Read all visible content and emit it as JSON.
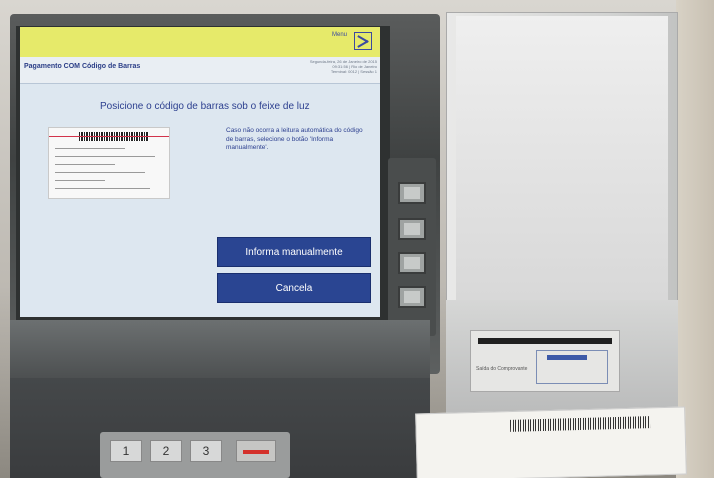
{
  "screen": {
    "header": {
      "menu_label": "Menu",
      "page_title": "Pagamento COM Código de Barras",
      "info_lines": [
        "Segunda-feira, 26 de Janeiro de 2015",
        "09:31:56 | Rio de Janeiro",
        "Terminal: 0012 | Sessão 1"
      ]
    },
    "instruction": "Posicione o código de barras sob o feixe de luz",
    "help_text": "Caso não ocorra a leitura automática do código de barras, selecione o botão 'Informa manualmente'.",
    "buttons": {
      "manual": "Informa manualmente",
      "cancel": "Cancela"
    }
  },
  "keypad": {
    "keys": [
      "1",
      "2",
      "3"
    ]
  },
  "receipt_slot_label": "Saída do Comprovante",
  "colors": {
    "header_yellow": "#e6ea6a",
    "button_blue": "#2a4592",
    "text_blue": "#2c3f8f",
    "screen_bg": "#dde7f0"
  }
}
